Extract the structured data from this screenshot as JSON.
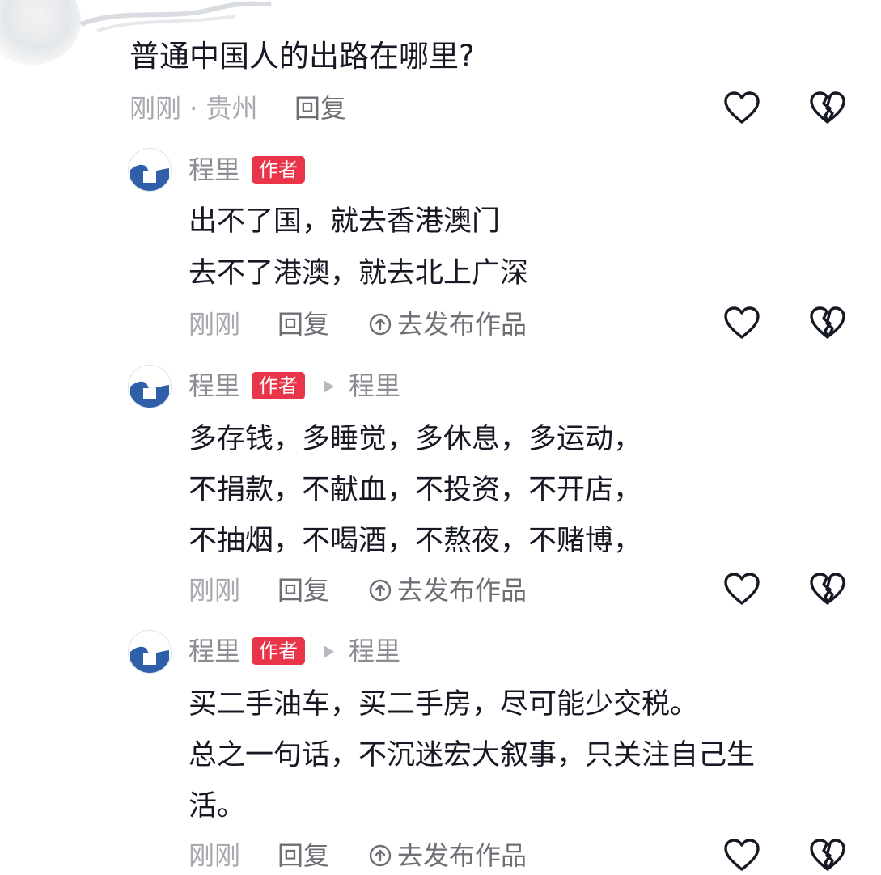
{
  "question": {
    "text": "普通中国人的出路在哪里?",
    "meta": "刚刚 · 贵州",
    "reply_label": "回复"
  },
  "replies": [
    {
      "author": "程里",
      "badge": "作者",
      "lines": [
        "出不了国，就去香港澳门",
        "去不了港澳，就去北上广深"
      ],
      "time": "刚刚",
      "reply_label": "回复",
      "publish_label": "去发布作品"
    },
    {
      "author": "程里",
      "badge": "作者",
      "reply_to": "程里",
      "lines": [
        "多存钱，多睡觉，多休息，多运动，",
        "不捐款，不献血，不投资，不开店，",
        "不抽烟，不喝酒，不熬夜，不赌博，"
      ],
      "time": "刚刚",
      "reply_label": "回复",
      "publish_label": "去发布作品"
    },
    {
      "author": "程里",
      "badge": "作者",
      "reply_to": "程里",
      "lines": [
        "买二手油车，买二手房，尽可能少交税。",
        "总之一句话，不沉迷宏大叙事，只关注自己生",
        "活。"
      ],
      "time": "刚刚",
      "reply_label": "回复",
      "publish_label": "去发布作品"
    }
  ],
  "icons": {
    "like": "heart-outline-icon",
    "dislike": "broken-heart-icon",
    "publish": "arrow-up-circle-icon",
    "reply_caret": "triangle-right-icon"
  },
  "colors": {
    "badge": "#e9354a",
    "text": "#161823",
    "meta": "#a7a9ae",
    "action": "#6d6f75",
    "avatar_blue": "#2f5fa8"
  }
}
